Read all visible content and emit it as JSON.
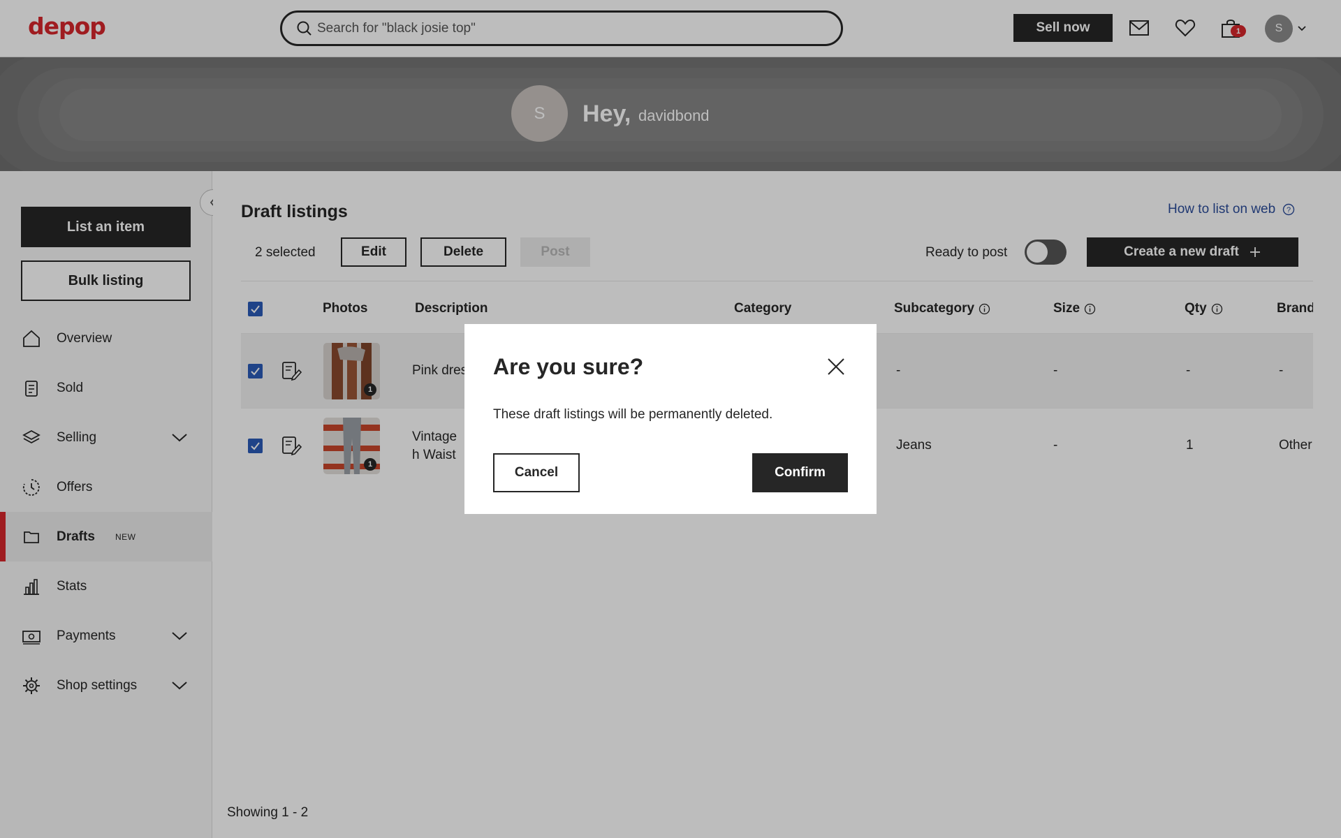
{
  "header": {
    "logo": "depop",
    "search_placeholder": "Search for \"black josie top\"",
    "sell_label": "Sell now",
    "cart_count": "1",
    "avatar_initial": "S",
    "icons": [
      "search-icon",
      "mail-icon",
      "heart-icon",
      "bag-icon",
      "chevron-down-icon"
    ]
  },
  "banner": {
    "avatar_initial": "S",
    "greeting": "Hey,",
    "username": "davidbond"
  },
  "sidebar": {
    "list_item_label": "List an item",
    "bulk_listing_label": "Bulk listing",
    "items": [
      {
        "label": "Overview",
        "icon": "home-icon"
      },
      {
        "label": "Sold",
        "icon": "receipt-icon"
      },
      {
        "label": "Selling",
        "icon": "layers-icon"
      },
      {
        "label": "Offers",
        "icon": "offers-icon"
      },
      {
        "label": "Drafts",
        "icon": "folder-icon",
        "badge": "NEW"
      },
      {
        "label": "Stats",
        "icon": "bar-chart-icon"
      },
      {
        "label": "Payments",
        "icon": "banknote-icon"
      },
      {
        "label": "Shop settings",
        "icon": "gear-icon"
      }
    ]
  },
  "main": {
    "title": "Draft listings",
    "how_to_label": "How to list on web",
    "selected_count": "2 selected",
    "edit_label": "Edit",
    "delete_label": "Delete",
    "post_label": "Post",
    "ready_label": "Ready to post",
    "create_label": "Create a new draft",
    "columns": {
      "photos": "Photos",
      "description": "Description",
      "category": "Category",
      "subcategory": "Subcategory",
      "size": "Size",
      "qty": "Qty",
      "brand": "Brand"
    },
    "rows": [
      {
        "description": "Pink dress",
        "subcategory": "-",
        "size": "-",
        "qty": "-",
        "brand": "-",
        "photo_count": "1"
      },
      {
        "description": "Vintage High Waist",
        "description_line1": "Vintage",
        "description_line2": "h Waist",
        "subcategory": "Jeans",
        "size": "-",
        "qty": "1",
        "brand": "Other",
        "photo_count": "1"
      }
    ],
    "showing": "Showing 1 - 2"
  },
  "modal": {
    "title": "Are you sure?",
    "text": "These draft listings will be permanently deleted.",
    "cancel_label": "Cancel",
    "confirm_label": "Confirm"
  },
  "colors": {
    "brand_red": "#d7272c",
    "dark": "#262626",
    "checkbox_blue": "#2b5bb8",
    "link_blue": "#2b4c9a"
  }
}
